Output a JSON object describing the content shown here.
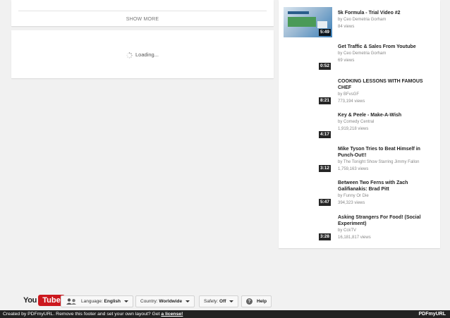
{
  "main": {
    "show_more_label": "SHOW MORE",
    "loading_label": "Loading..."
  },
  "related": [
    {
      "title": "5k Formula - Trial Video #2",
      "by": "by Ceo Demetria Gorham",
      "views": "84 views",
      "duration": "5:49",
      "has_thumb": true
    },
    {
      "title": "Get Traffic & Sales From Youtube",
      "by": "by Ceo Demetria Gorham",
      "views": "69 views",
      "duration": "0:52",
      "has_thumb": false
    },
    {
      "title": "COOKING LESSONS WITH FAMOUS CHEF",
      "by": "by BFvsGF",
      "views": "773,194 views",
      "duration": "8:21",
      "has_thumb": false
    },
    {
      "title": "Key & Peele - Make-A-Wish",
      "by": "by Comedy Central",
      "views": "1,919,218 views",
      "duration": "4:17",
      "has_thumb": false
    },
    {
      "title": "Mike Tyson Tries to Beat Himself in Punch-Out!!",
      "by": "by The Tonight Show Starring Jimmy Fallon",
      "views": "1,759,163 views",
      "duration": "3:12",
      "has_thumb": false
    },
    {
      "title": "Between Two Ferns with Zach Galifianakis: Brad Pitt",
      "by": "by Funny Or Die",
      "views": "394,323 views",
      "duration": "5:47",
      "has_thumb": false
    },
    {
      "title": "Asking Strangers For Food! (Social Experiment)",
      "by": "by CckTV",
      "views": "16,181,817 views",
      "duration": "3:28",
      "has_thumb": false
    }
  ],
  "footer": {
    "logo_you": "You",
    "logo_tube": "Tube",
    "language_prefix": "Language:",
    "language_value": "English",
    "country_prefix": "Country:",
    "country_value": "Worldwide",
    "safety_prefix": "Safety:",
    "safety_value": "Off",
    "help_label": "Help",
    "help_icon_glyph": "?"
  },
  "pdf_bar": {
    "message": "Created by PDFmyURL. Remove this footer and set your own layout? Get",
    "link": "a license!",
    "brand": "PDFmyURL"
  },
  "colors": {
    "youtube_red": "#cc181e",
    "page_bg": "#f1f1f1",
    "bar_bg": "#222222"
  }
}
